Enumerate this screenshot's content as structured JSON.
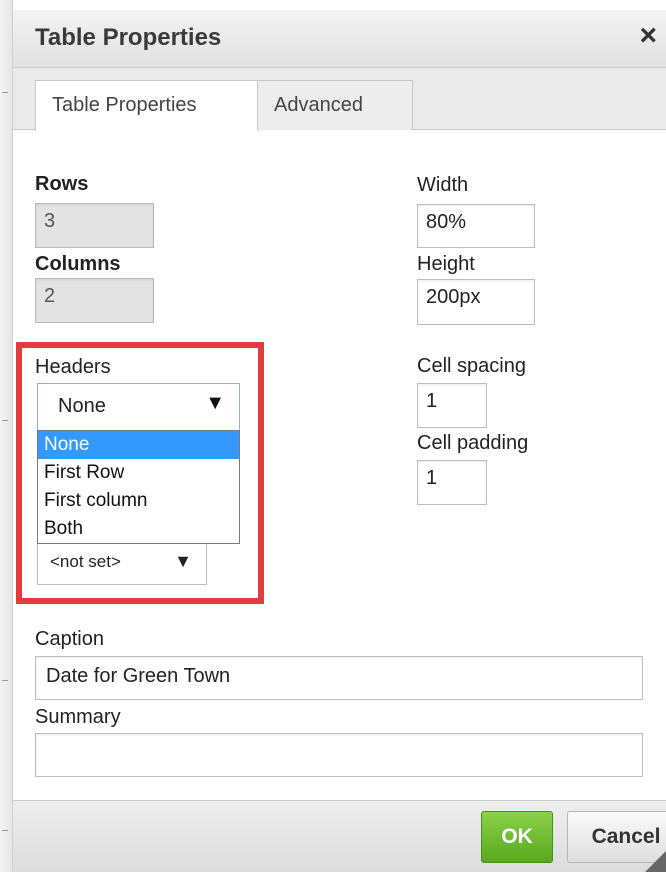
{
  "dialog": {
    "title": "Table Properties",
    "close_icon": "×",
    "tabs": [
      {
        "label": "Table Properties",
        "active": true
      },
      {
        "label": "Advanced",
        "active": false
      }
    ]
  },
  "form": {
    "rows": {
      "label": "Rows",
      "value": "3"
    },
    "columns": {
      "label": "Columns",
      "value": "2"
    },
    "width": {
      "label": "Width",
      "value": "80%"
    },
    "height": {
      "label": "Height",
      "value": "200px"
    },
    "headers": {
      "label": "Headers",
      "selected": "None",
      "arrow": "▼",
      "options": [
        "None",
        "First Row",
        "First column",
        "Both"
      ]
    },
    "border_select": {
      "value": "<not set>",
      "arrow": "▼"
    },
    "cell_spacing": {
      "label": "Cell spacing",
      "value": "1"
    },
    "cell_padding": {
      "label": "Cell padding",
      "value": "1"
    },
    "caption": {
      "label": "Caption",
      "value": "Date for Green Town"
    },
    "summary": {
      "label": "Summary",
      "value": ""
    }
  },
  "footer": {
    "ok_label": "OK",
    "cancel_label": "Cancel"
  },
  "colors": {
    "highlight": "#e23b3b",
    "ok_button": "#6bbf2f",
    "dropdown_selected": "#3399ff"
  }
}
